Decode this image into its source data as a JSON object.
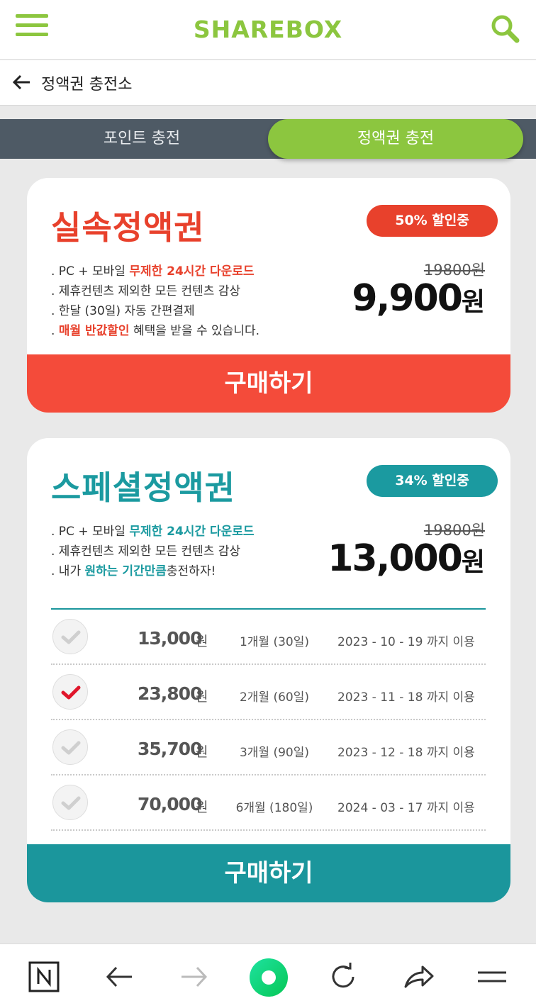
{
  "header": {
    "logo": "SHAREBOX"
  },
  "subheader": {
    "title": "정액권 충전소"
  },
  "tabs": [
    {
      "label": "포인트 충전",
      "active": false
    },
    {
      "label": "정액권 충전",
      "active": true
    }
  ],
  "plan_basic": {
    "name": "실속정액권",
    "badge": "50% 할인중",
    "desc_lines": [
      {
        "pre": ". PC + 모바일 ",
        "hl": "무제한 24시간 다운로드",
        "post": ""
      },
      {
        "pre": ". 제휴컨텐츠 제외한 모든 컨텐츠 감상",
        "hl": "",
        "post": ""
      },
      {
        "pre": ". 한달 (30일) 자동 간편결제",
        "hl": "",
        "post": ""
      },
      {
        "pre": ". ",
        "hl": "매월 반값할인",
        "post": " 혜택을 받을 수 있습니다."
      }
    ],
    "original_price": "19800원",
    "price": "9,900",
    "price_unit": "원",
    "buy_label": "구매하기",
    "accent_color": "#e8412c"
  },
  "plan_special": {
    "name": "스페셜정액권",
    "badge": "34% 할인중",
    "desc_lines": [
      {
        "pre": ". PC + 모바일 ",
        "hl": "무제한 24시간 다운로드",
        "post": ""
      },
      {
        "pre": ". 제휴컨텐츠 제외한 모든 컨텐츠 감상",
        "hl": "",
        "post": ""
      },
      {
        "pre": ". 내가 ",
        "hl": "원하는 기간만큼",
        "post": "충전하자!"
      }
    ],
    "original_price": "19800원",
    "price": "13,000",
    "price_unit": "원",
    "buy_label": "구매하기",
    "accent_color": "#1b9aa0",
    "options": [
      {
        "price": "13,000",
        "won": "원",
        "period": "1개월 (30일)",
        "until": "2023 - 10 - 19 까지 이용",
        "selected": false
      },
      {
        "price": "23,800",
        "won": "원",
        "period": "2개월 (60일)",
        "until": "2023 - 11 - 18 까지 이용",
        "selected": true
      },
      {
        "price": "35,700",
        "won": "원",
        "period": "3개월 (90일)",
        "until": "2023 - 12 - 18 까지 이용",
        "selected": false
      },
      {
        "price": "70,000",
        "won": "원",
        "period": "6개월 (180일)",
        "until": "2024 - 03 - 17 까지 이용",
        "selected": false
      }
    ]
  },
  "bottom_bar": {
    "icons": [
      "naver-icon",
      "back-arrow-icon",
      "forward-arrow-icon",
      "home-circle-icon",
      "refresh-icon",
      "share-icon",
      "menu-icon"
    ]
  },
  "colors": {
    "brand_green": "#8cc63f",
    "red": "#e8412c",
    "teal": "#1b9aa0",
    "tabbar": "#4e5a65"
  }
}
